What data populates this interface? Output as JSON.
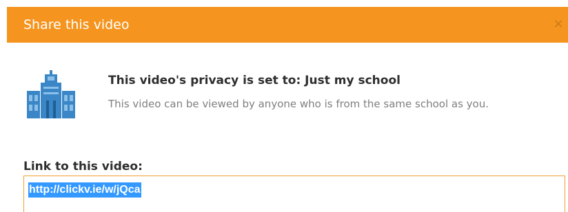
{
  "dialog": {
    "title": "Share this video",
    "close_label": "×"
  },
  "privacy": {
    "icon": "school-building-icon",
    "title": "This video's privacy is set to: Just my school",
    "description": "This video can be viewed by anyone who is from the same school as you."
  },
  "link": {
    "label": "Link to this video:",
    "value": "http://clickv.ie/w/jQca"
  },
  "colors": {
    "header": "#f5951f",
    "icon": "#3a86c6",
    "selection": "#3399ff"
  }
}
